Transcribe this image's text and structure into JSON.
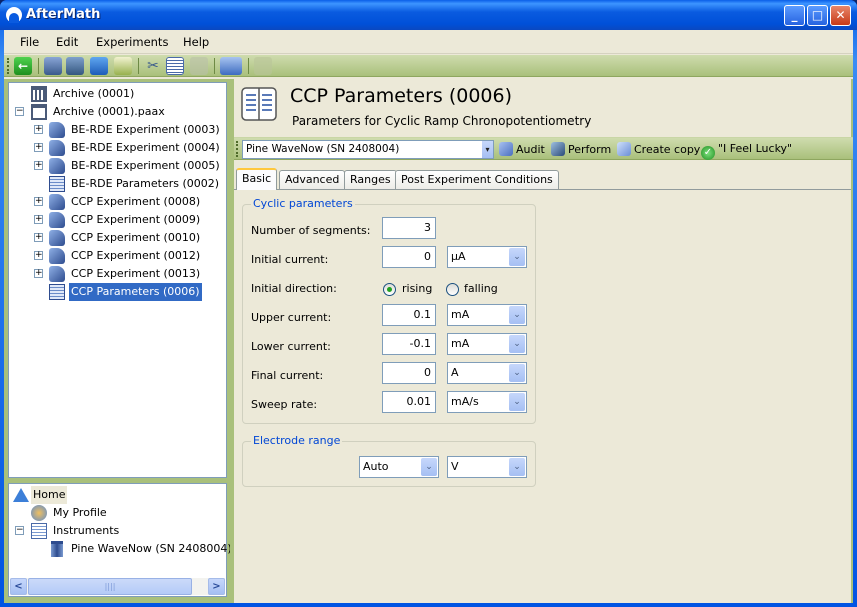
{
  "window": {
    "title": "AfterMath",
    "controls": {
      "minimize": "_",
      "maximize": "□",
      "close": "✕"
    }
  },
  "menubar": {
    "items": [
      {
        "label": "File",
        "mnemonic": "F"
      },
      {
        "label": "Edit",
        "mnemonic": "E"
      },
      {
        "label": "Experiments",
        "mnemonic": "x"
      },
      {
        "label": "Help",
        "mnemonic": "H"
      }
    ]
  },
  "toolbar": {
    "icons": [
      "back-icon",
      "new-archive-icon",
      "open-archive-icon",
      "save-icon",
      "print-icon",
      "cut-icon",
      "copy-icon",
      "paste-icon",
      "new-experiment-dropdown-icon",
      "chart-icon"
    ]
  },
  "archive_tree": {
    "items": [
      {
        "label": "Archive (0001)",
        "icon": "archive-icon",
        "level": 0,
        "expander": ""
      },
      {
        "label": "Archive (0001).paax",
        "icon": "archive-open-icon",
        "level": 0,
        "expander": "−"
      },
      {
        "label": "BE-RDE Experiment (0003)",
        "icon": "experiment-icon",
        "level": 1,
        "expander": "+"
      },
      {
        "label": "BE-RDE Experiment (0004)",
        "icon": "experiment-icon",
        "level": 1,
        "expander": "+"
      },
      {
        "label": "BE-RDE Experiment (0005)",
        "icon": "experiment-icon",
        "level": 1,
        "expander": "+"
      },
      {
        "label": "BE-RDE Parameters (0002)",
        "icon": "parameters-icon",
        "level": 1,
        "expander": ""
      },
      {
        "label": "CCP Experiment (0008)",
        "icon": "experiment-icon",
        "level": 1,
        "expander": "+"
      },
      {
        "label": "CCP Experiment (0009)",
        "icon": "experiment-icon",
        "level": 1,
        "expander": "+"
      },
      {
        "label": "CCP Experiment (0010)",
        "icon": "experiment-icon",
        "level": 1,
        "expander": "+"
      },
      {
        "label": "CCP Experiment (0012)",
        "icon": "experiment-icon",
        "level": 1,
        "expander": "+"
      },
      {
        "label": "CCP Experiment (0013)",
        "icon": "experiment-icon",
        "level": 1,
        "expander": "+"
      },
      {
        "label": "CCP Parameters (0006)",
        "icon": "parameters-icon",
        "level": 1,
        "expander": "",
        "selected": true
      }
    ]
  },
  "home_tree": {
    "items": [
      {
        "label": "Home",
        "icon": "home-icon"
      },
      {
        "label": "My Profile",
        "icon": "profile-icon"
      },
      {
        "label": "Instruments",
        "icon": "instruments-icon",
        "expander": "−"
      },
      {
        "label": "Pine WaveNow (SN 2408004)",
        "icon": "instrument-icon"
      }
    ],
    "scroll": {
      "left": "<",
      "right": ">",
      "thumb": "||||"
    }
  },
  "header": {
    "title": "CCP Parameters (0006)",
    "subtitle": "Parameters for Cyclic Ramp Chronopotentiometry"
  },
  "action_bar": {
    "instrument": "Pine WaveNow (SN 2408004)",
    "instrument_arrow": "▾",
    "buttons": [
      {
        "label": "Audit",
        "icon": "audit-icon",
        "color": "#4a6fc0"
      },
      {
        "label": "Perform",
        "icon": "perform-icon",
        "color": "#3a6aa8"
      },
      {
        "label": "Create copy",
        "icon": "create-copy-icon",
        "color": "#6a8ed6"
      },
      {
        "label": "\"I Feel Lucky\"",
        "icon": "check-icon",
        "color": "#2a9d2a"
      }
    ]
  },
  "tabs": [
    {
      "label": "Basic",
      "active": true
    },
    {
      "label": "Advanced"
    },
    {
      "label": "Ranges"
    },
    {
      "label": "Post Experiment Conditions"
    }
  ],
  "cyclic": {
    "title": "Cyclic parameters",
    "segments": {
      "label": "Number of segments:",
      "value": "3"
    },
    "initial_current": {
      "label": "Initial current:",
      "value": "0",
      "unit": "µA"
    },
    "initial_direction": {
      "label": "Initial direction:",
      "options": [
        "rising",
        "falling"
      ],
      "selected": "rising"
    },
    "upper_current": {
      "label": "Upper current:",
      "value": "0.1",
      "unit": "mA"
    },
    "lower_current": {
      "label": "Lower current:",
      "value": "-0.1",
      "unit": "mA"
    },
    "final_current": {
      "label": "Final current:",
      "value": "0",
      "unit": "A"
    },
    "sweep_rate": {
      "label": "Sweep rate:",
      "value": "0.01",
      "unit": "mA/s"
    }
  },
  "electrode": {
    "title": "Electrode range",
    "range": "Auto",
    "unit": "V"
  },
  "combo_arrow": "⌄"
}
